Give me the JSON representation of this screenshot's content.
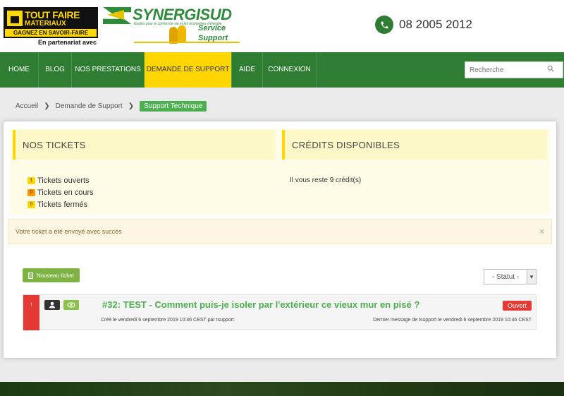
{
  "header": {
    "logo1": {
      "title": "TOUT FAIRE",
      "subtitle": "MATERIAUX",
      "tagline": "GAGNEZ EN SAVOIR-FAIRE",
      "partner": "En partenariat avec"
    },
    "logo2": {
      "name": "SYNERGISUD",
      "tagline": "Etudes pour le confort de vie et les économies d'énergie",
      "service": "Service",
      "support": "Support"
    },
    "phone": "08 2005 2012"
  },
  "nav": {
    "items": [
      "HOME",
      "BLOG",
      "NOS PRESTATIONS",
      "DEMANDE DE SUPPORT",
      "AIDE",
      "CONNEXION"
    ],
    "search_placeholder": "Recherche"
  },
  "breadcrumb": {
    "items": [
      "Accueil",
      "Demande de Support"
    ],
    "current": "Support Technique"
  },
  "stats": {
    "tickets_title": "NOS TICKETS",
    "credits_title": "CRÉDITS DISPONIBLES",
    "lines": [
      {
        "count": "1",
        "label": "Tickets ouverts",
        "color": "#ffd600"
      },
      {
        "count": "0",
        "label": "Tickets en cours",
        "color": "#ff9800"
      },
      {
        "count": "0",
        "label": "Tickets fermés",
        "color": "#ffd600"
      }
    ],
    "credits_text": "Il vous reste 9 crédit(s)"
  },
  "alert": {
    "text": "Votre ticket a été envoyé avec succès",
    "close": "×"
  },
  "toolbar": {
    "new_ticket": "Nouveau ticket",
    "status_select": "- Statut -"
  },
  "ticket": {
    "priority": "↑",
    "title": "#32: TEST - Comment puis-je isoler par l'extérieur ce vieux mur en pisé ?",
    "created": "Créé le vendredi 6 septembre 2019 10:46 CEST par tsupport",
    "last_message": "Dernier message de tsupport le vendredi 6 septembre 2019 10:46 CEST",
    "status": "Ouvert"
  },
  "colors": {
    "brand_green": "#2e7d32",
    "accent_yellow": "#ffd600",
    "danger": "#e53935"
  }
}
